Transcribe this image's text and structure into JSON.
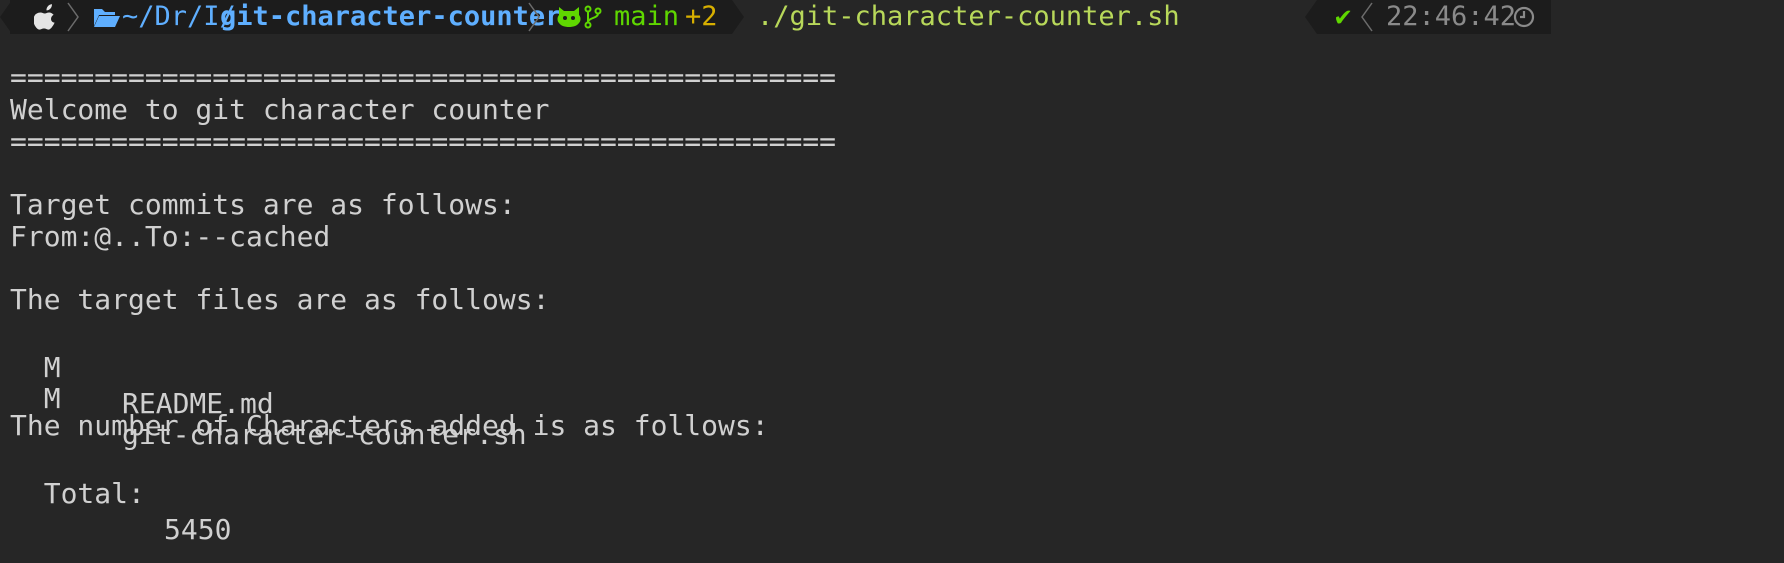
{
  "prompt": {
    "path_prefix": "~/Dr/I/",
    "path_current": "git-character-counter",
    "branch": "main",
    "changes": "+2",
    "command": "./git-character-counter.sh",
    "status": "✔",
    "time": "22:46:42",
    "icons": [
      "apple-icon",
      "folder-open-icon",
      "github-icon",
      "git-branch-icon",
      "check-icon",
      "clock-icon"
    ]
  },
  "output": {
    "rule_top": "=================================================",
    "welcome": "Welcome to git character counter",
    "rule_bottom": "=================================================",
    "commits_heading": "Target commits are as follows:",
    "commits_range": "From:@..To:--cached",
    "files_heading": "The target files are as follows:",
    "files": [
      {
        "status": "M",
        "name": "README.md"
      },
      {
        "status": "M",
        "name": "git-character-counter.sh"
      }
    ],
    "count_heading": "The number of Characters added is as follows:",
    "total_label": "Total:",
    "total_value": "5450"
  },
  "colors": {
    "background": "#262626",
    "path": "#5fafff",
    "git": "#5fd700",
    "changes": "#d7af00",
    "command": "#b8d85a"
  }
}
